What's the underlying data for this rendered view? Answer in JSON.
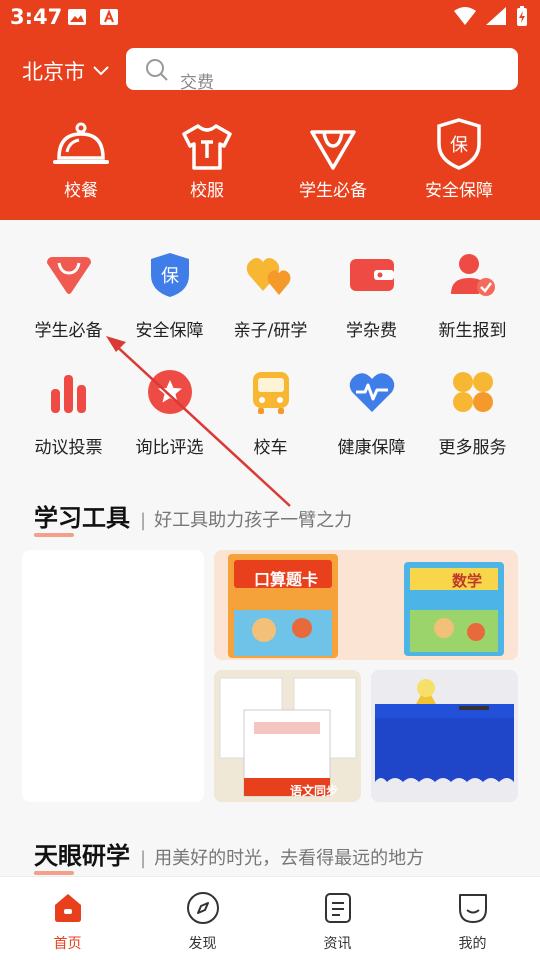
{
  "status": {
    "time": "3:47"
  },
  "header": {
    "city": "北京市",
    "search_placeholder": "交费",
    "topnav": [
      {
        "label": "校餐",
        "icon": "cloche-icon"
      },
      {
        "label": "校服",
        "icon": "tshirt-icon"
      },
      {
        "label": "学生必备",
        "icon": "shopping-bag-icon"
      },
      {
        "label": "安全保障",
        "icon": "shield-bao-icon"
      }
    ]
  },
  "services": {
    "row1": [
      {
        "label": "学生必备",
        "icon": "shopping-bag-icon"
      },
      {
        "label": "安全保障",
        "icon": "shield-bao-icon"
      },
      {
        "label": "亲子/研学",
        "icon": "hearts-icon"
      },
      {
        "label": "学杂费",
        "icon": "wallet-icon"
      },
      {
        "label": "新生报到",
        "icon": "user-check-icon"
      }
    ],
    "row2": [
      {
        "label": "动议投票",
        "icon": "bar-chart-icon"
      },
      {
        "label": "询比评选",
        "icon": "star-icon"
      },
      {
        "label": "校车",
        "icon": "bus-icon"
      },
      {
        "label": "健康保障",
        "icon": "heartbeat-icon"
      },
      {
        "label": "更多服务",
        "icon": "grid-more-icon"
      }
    ]
  },
  "tools": {
    "title": "学习工具",
    "subtitle": "好工具助力孩子一臂之力",
    "book1_title": "口算题卡",
    "book2_title": "数学",
    "card3_caption": "语文同步"
  },
  "study": {
    "title": "天眼研学",
    "subtitle": "用美好的时光，去看得最远的地方"
  },
  "bottomnav": [
    {
      "label": "首页",
      "icon": "home-icon",
      "active": true
    },
    {
      "label": "发现",
      "icon": "compass-icon",
      "active": false
    },
    {
      "label": "资讯",
      "icon": "document-icon",
      "active": false
    },
    {
      "label": "我的",
      "icon": "smile-icon",
      "active": false
    }
  ],
  "colors": {
    "brand": "#e8401c"
  }
}
